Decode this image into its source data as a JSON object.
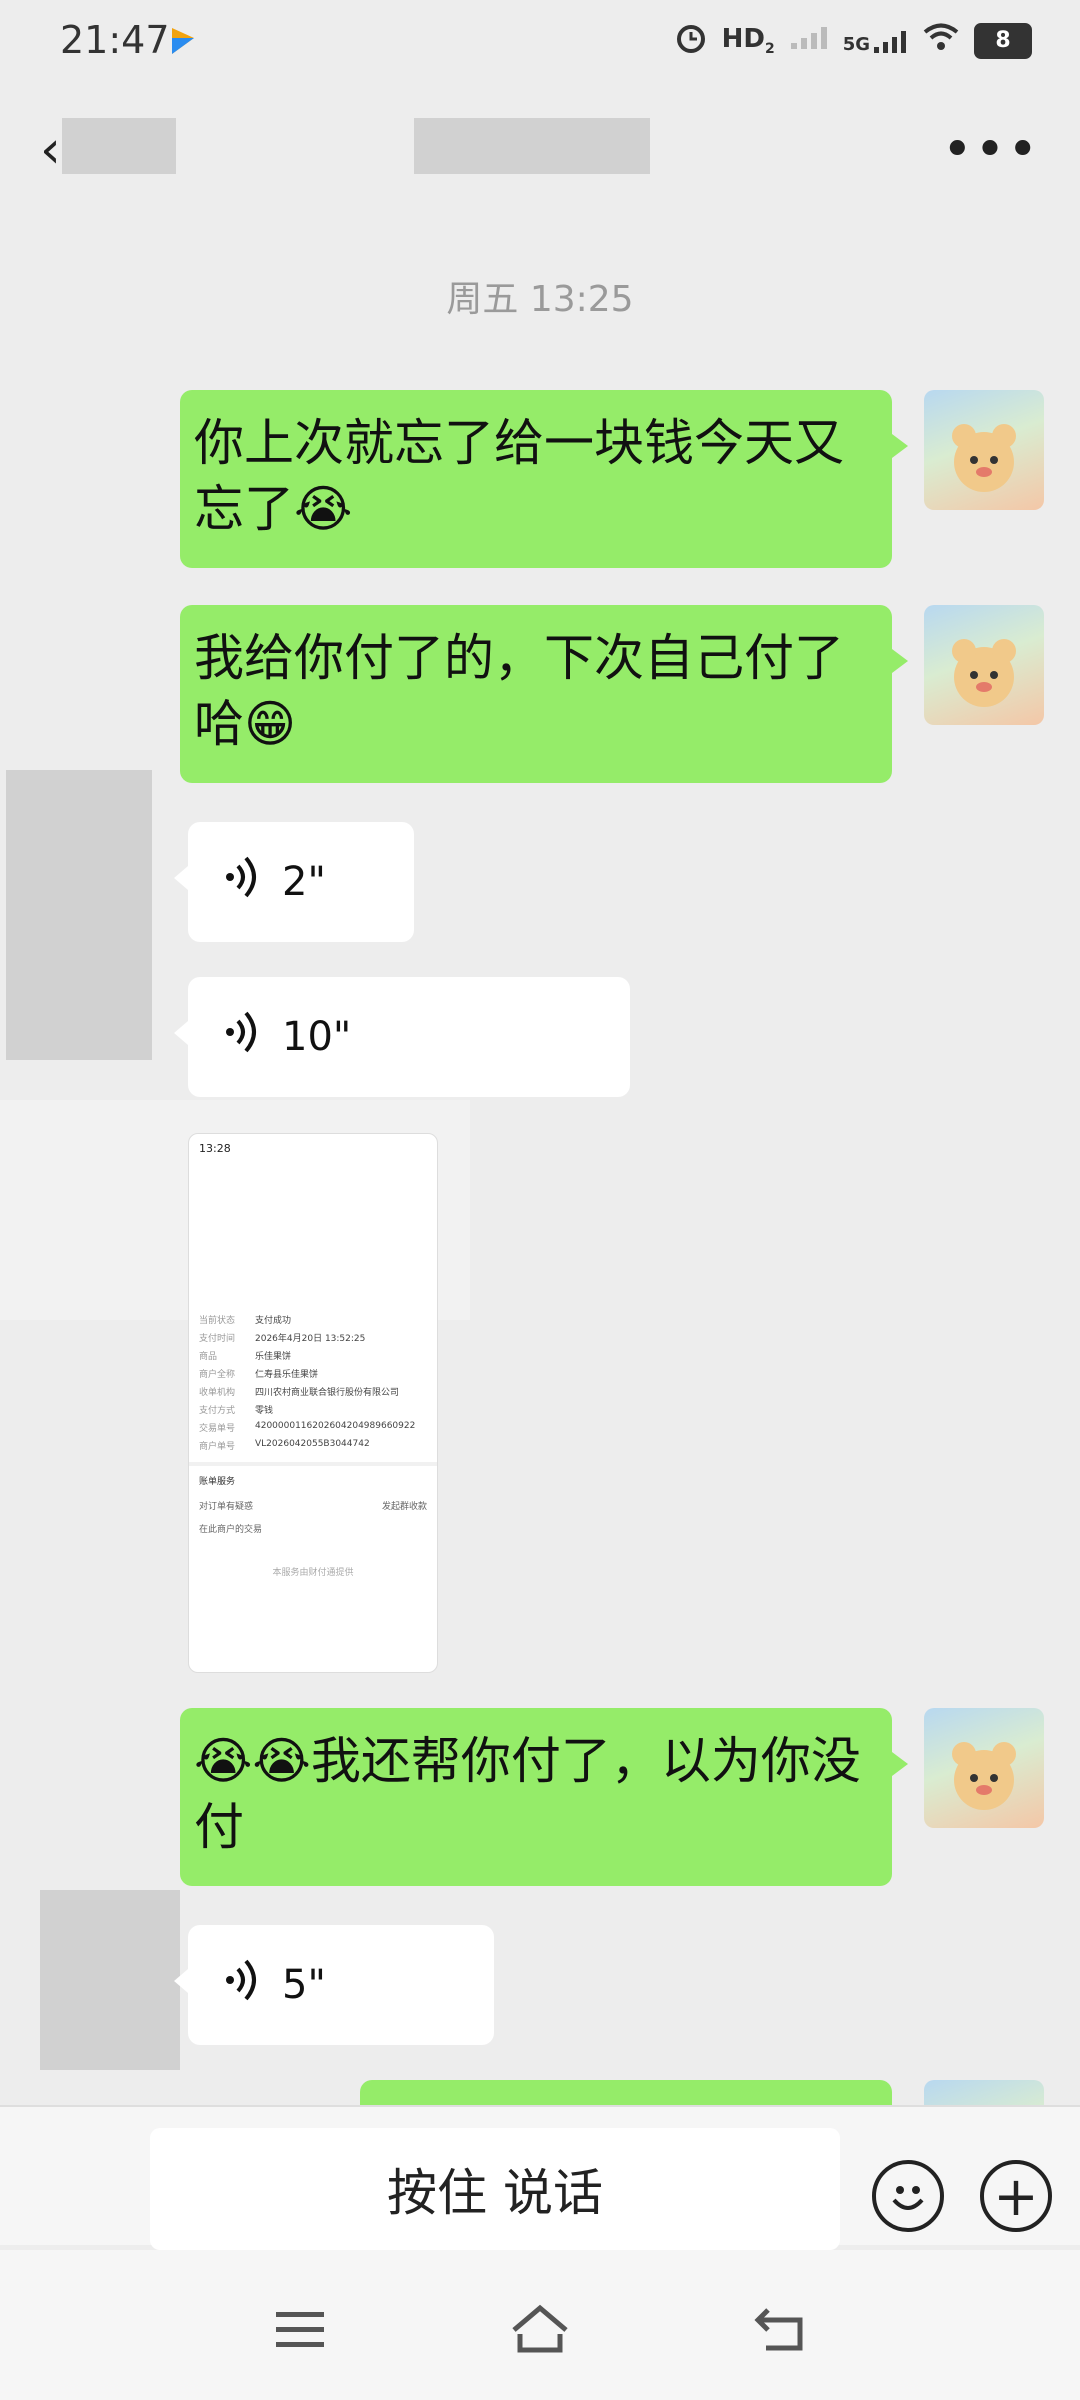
{
  "status_bar": {
    "time": "21:47",
    "network": "5G",
    "battery": "8"
  },
  "header": {
    "back_glyph": "‹",
    "more_glyph": "•••"
  },
  "time_separator": "周五 13:25",
  "messages": [
    {
      "side": "right",
      "type": "text",
      "text": "你上次就忘了给一块钱今天又忘了😭"
    },
    {
      "side": "right",
      "type": "text",
      "text": "我给你付了的，下次自己付了哈😁"
    },
    {
      "side": "left",
      "type": "voice",
      "duration": "2\""
    },
    {
      "side": "left",
      "type": "voice",
      "duration": "10\""
    },
    {
      "side": "left",
      "type": "image",
      "screenshot": {
        "time": "13:28",
        "rows": [
          [
            "当前状态",
            "支付成功"
          ],
          [
            "支付时间",
            "2026年4月20日 13:52:25"
          ],
          [
            "商品",
            "乐佳果饼"
          ],
          [
            "商户全称",
            "仁寿县乐佳果饼"
          ],
          [
            "收单机构",
            "四川农村商业联合银行股份有限公司"
          ],
          [
            "支付方式",
            "零钱"
          ],
          [
            "交易单号",
            "4200000116202604204989660922"
          ],
          [
            "商户单号",
            "VL2026042055B3044742"
          ]
        ],
        "service_title": "账单服务",
        "service_items": [
          "对订单有疑惑",
          "发起群收款",
          "在此商户的交易"
        ],
        "footer": "本服务由财付通提供"
      }
    },
    {
      "side": "right",
      "type": "text",
      "text": "😭😭我还帮你付了，以为你没付"
    },
    {
      "side": "left",
      "type": "voice",
      "duration": "5\""
    }
  ],
  "input": {
    "press_to_talk": "按住 说话",
    "emoji_glyph": "☺",
    "plus_glyph": "+"
  },
  "colors": {
    "bubble_right": "#95ec69",
    "bubble_left": "#ffffff",
    "background": "#ededed"
  }
}
